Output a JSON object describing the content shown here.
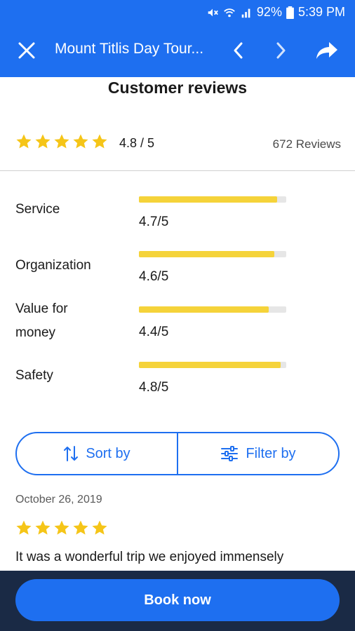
{
  "status_bar": {
    "battery": "92%",
    "time": "5:39 PM",
    "icons": [
      "mute-icon",
      "wifi-icon",
      "signal-icon",
      "battery-icon"
    ]
  },
  "toolbar": {
    "title": "Mount Titlis Day Tour...",
    "icons": [
      "close-icon",
      "chevron-left-icon",
      "chevron-right-icon",
      "share-icon"
    ]
  },
  "reviews": {
    "heading": "Customer reviews",
    "overall_score": "4.8 / 5",
    "overall_stars": 5,
    "review_count": "672 Reviews",
    "categories": [
      {
        "label": "Service",
        "value": "4.7/5",
        "fill": 0.94
      },
      {
        "label": "Organization",
        "value": "4.6/5",
        "fill": 0.92
      },
      {
        "label": "Value for money",
        "label_line1": "Value for",
        "label_line2": "money",
        "value": "4.4/5",
        "fill": 0.88
      },
      {
        "label": "Safety",
        "value": "4.8/5",
        "fill": 0.96
      }
    ]
  },
  "controls": {
    "sort_label": "Sort by",
    "filter_label": "Filter by"
  },
  "review": {
    "date": "October 26, 2019",
    "stars": 5,
    "text": "It was a wonderful trip we enjoyed immensely"
  },
  "footer": {
    "book_label": "Book now"
  },
  "colors": {
    "primary": "#1e6ff0",
    "star": "#f5c518",
    "bar_fill": "#f5d33a",
    "footer_bg": "#1a2a45"
  }
}
